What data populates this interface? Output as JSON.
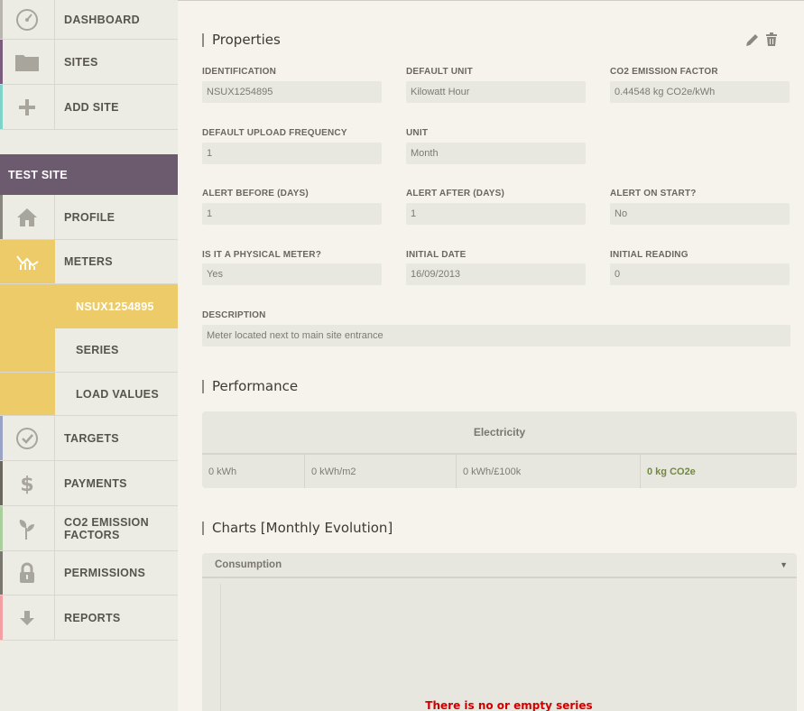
{
  "sidebar": {
    "items_top": [
      {
        "label": "DASHBOARD",
        "icon": "dashboard-gauge-icon",
        "accent": "#b7b5ad"
      },
      {
        "label": "SITES",
        "icon": "folder-icon",
        "accent": "#7b5c7f"
      },
      {
        "label": "ADD SITE",
        "icon": "plus-icon",
        "accent": "#7fd3c8"
      }
    ],
    "site_name": "TEST SITE",
    "site_items": [
      {
        "label": "PROFILE",
        "icon": "home-icon",
        "accent": "#8a8780"
      },
      {
        "label": "METERS",
        "icon": "meters-chart-icon",
        "accent": "#eccb68"
      }
    ],
    "meter_sub_items": [
      {
        "label": "NSUX1254895",
        "active": true
      },
      {
        "label": "SERIES"
      },
      {
        "label": "LOAD VALUES"
      }
    ],
    "items_bottom": [
      {
        "label": "TARGETS",
        "icon": "checkmark-icon",
        "accent": "#9aa3c6"
      },
      {
        "label": "PAYMENTS",
        "icon": "dollar-icon",
        "accent": "#6a675f"
      },
      {
        "label": "CO2 EMISSION",
        "label2": "FACTORS",
        "icon": "leaf-plant-icon",
        "accent": "#a9cf9d"
      },
      {
        "label": "PERMISSIONS",
        "icon": "lock-icon",
        "accent": "#7a776f"
      },
      {
        "label": "REPORTS",
        "icon": "download-arrow-icon",
        "accent": "#f2a0a4"
      }
    ]
  },
  "properties": {
    "title": "Properties",
    "fields": {
      "identification": {
        "label": "IDENTIFICATION",
        "value": "NSUX1254895"
      },
      "default_unit": {
        "label": "DEFAULT UNIT",
        "value": "Kilowatt Hour"
      },
      "co2_factor": {
        "label": "CO2 EMISSION FACTOR",
        "value": "0.44548 kg CO2e/kWh"
      },
      "upload_freq": {
        "label": "DEFAULT UPLOAD FREQUENCY",
        "value": "1"
      },
      "unit": {
        "label": "UNIT",
        "value": "Month"
      },
      "alert_before": {
        "label": "ALERT BEFORE (DAYS)",
        "value": "1"
      },
      "alert_after": {
        "label": "ALERT AFTER (DAYS)",
        "value": "1"
      },
      "alert_on_start": {
        "label": "ALERT ON START?",
        "value": "No"
      },
      "physical": {
        "label": "IS IT A PHYSICAL METER?",
        "value": "Yes"
      },
      "initial_date": {
        "label": "INITIAL DATE",
        "value": "16/09/2013"
      },
      "initial_reading": {
        "label": "INITIAL READING",
        "value": "0"
      },
      "description": {
        "label": "DESCRIPTION",
        "value": "Meter located next to main site entrance"
      }
    }
  },
  "performance": {
    "title": "Performance",
    "category": "Electricity",
    "cells": [
      "0 kWh",
      "0 kWh/m2",
      "0 kWh/£100k",
      "0 kg CO2e"
    ],
    "highlight_color": "#6f8a3a"
  },
  "charts": {
    "title": "Charts [Monthly Evolution]",
    "selected": "Consumption",
    "empty_message": "There is no or empty series"
  },
  "colors": {
    "sidebar_bg": "#ecebe4",
    "site_header_bg": "#6c5a6e",
    "meters_active_bg": "#eccb68",
    "main_bg": "#f5f3ec",
    "error_text": "#d00000"
  }
}
